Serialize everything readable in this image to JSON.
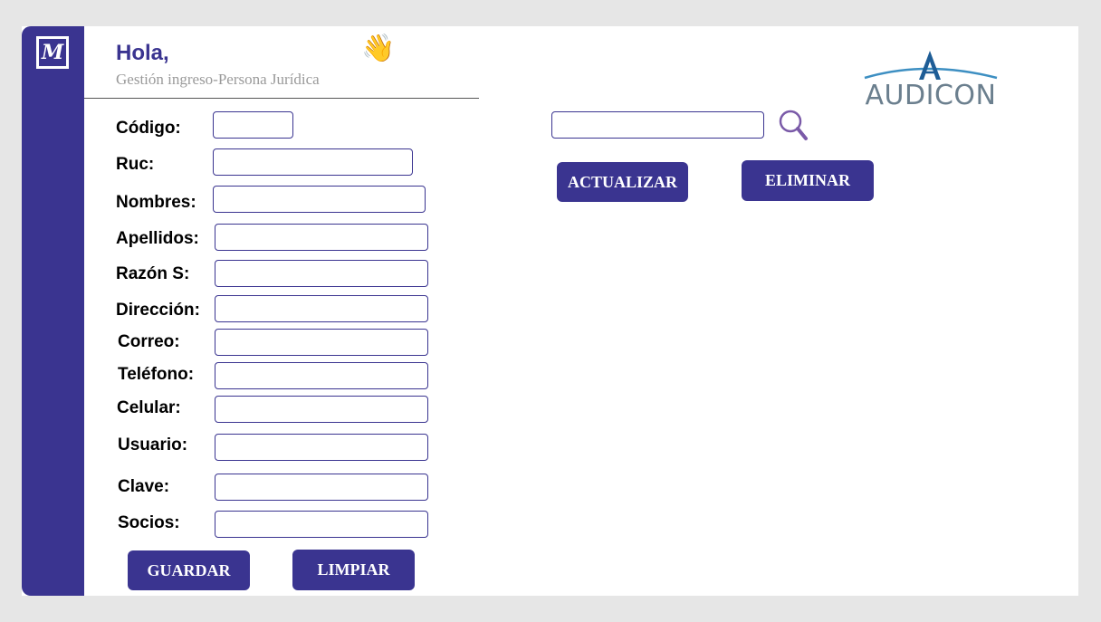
{
  "header": {
    "greeting": "Hola,",
    "subtitle": "Gestión ingreso-Persona Jurídica",
    "wave_emoji": "👋",
    "app_logo_letter": "M",
    "brand_name": "AUDICON"
  },
  "form": {
    "fields": [
      {
        "label": "Código:",
        "value": ""
      },
      {
        "label": "Ruc:",
        "value": ""
      },
      {
        "label": "Nombres:",
        "value": ""
      },
      {
        "label": "Apellidos:",
        "value": ""
      },
      {
        "label": "Razón S:",
        "value": ""
      },
      {
        "label": "Dirección:",
        "value": ""
      },
      {
        "label": "Correo:",
        "value": ""
      },
      {
        "label": "Teléfono:",
        "value": ""
      },
      {
        "label": "Celular:",
        "value": ""
      },
      {
        "label": "Usuario:",
        "value": ""
      },
      {
        "label": "Clave:",
        "value": ""
      },
      {
        "label": "Socios:",
        "value": ""
      }
    ],
    "save_label": "GUARDAR",
    "clear_label": "LIMPIAR"
  },
  "search": {
    "value": "",
    "update_label": "ACTUALIZAR",
    "delete_label": "ELIMINAR"
  },
  "colors": {
    "primary": "#3a3490",
    "background": "#e6e6e6",
    "brand_text": "#6b7f8e",
    "search_icon": "#7a5aa8"
  },
  "icons": {
    "app_logo": "m-logo-icon",
    "wave": "waving-hand-icon",
    "search": "search-icon",
    "brand": "audicon-logo-icon"
  }
}
